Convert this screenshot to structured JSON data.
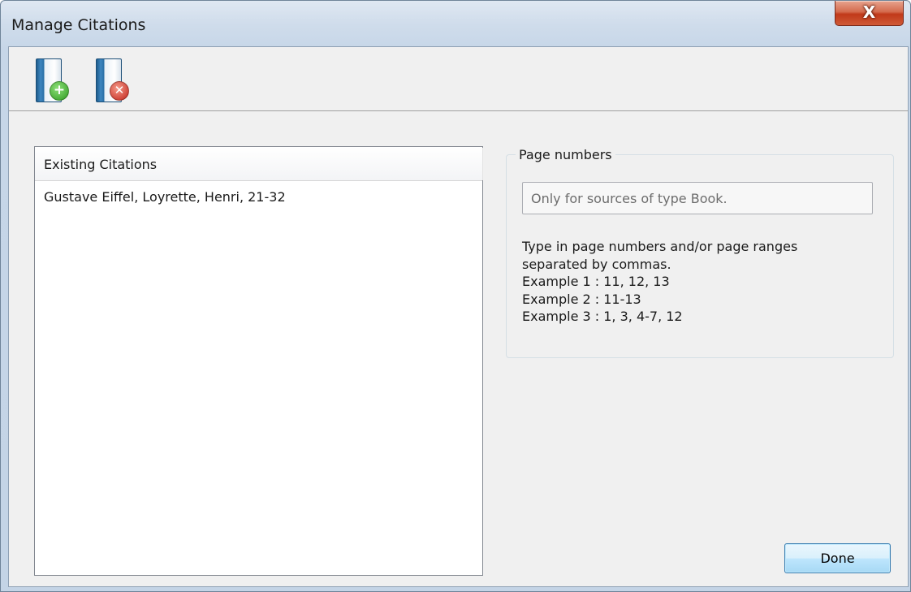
{
  "window": {
    "title": "Manage Citations",
    "close_glyph": "X",
    "close_icon": "close-icon",
    "accent_color": "#c6d6e8"
  },
  "toolbar": {
    "buttons": [
      {
        "name": "add-citation-button",
        "icon": "book-add-icon",
        "badge_glyph": "+",
        "badge_color": "#2e9a1f"
      },
      {
        "name": "remove-citation-button",
        "icon": "book-remove-icon",
        "badge_glyph": "✕",
        "badge_color": "#c1231a"
      }
    ]
  },
  "citations": {
    "header": "Existing Citations",
    "items": [
      "Gustave Eiffel, Loyrette, Henri, 21-32"
    ]
  },
  "page_numbers": {
    "legend": "Page numbers",
    "input_value": "",
    "input_placeholder": "Only for sources of type Book.",
    "help_lines": [
      "Type in page numbers and/or page ranges",
      "separated by commas.",
      "Example 1 : 11, 12, 13",
      "Example 2 : 11-13",
      "Example 3 : 1, 3, 4-7, 12"
    ]
  },
  "footer": {
    "done_label": "Done",
    "done_color": "#3c7fb1"
  }
}
